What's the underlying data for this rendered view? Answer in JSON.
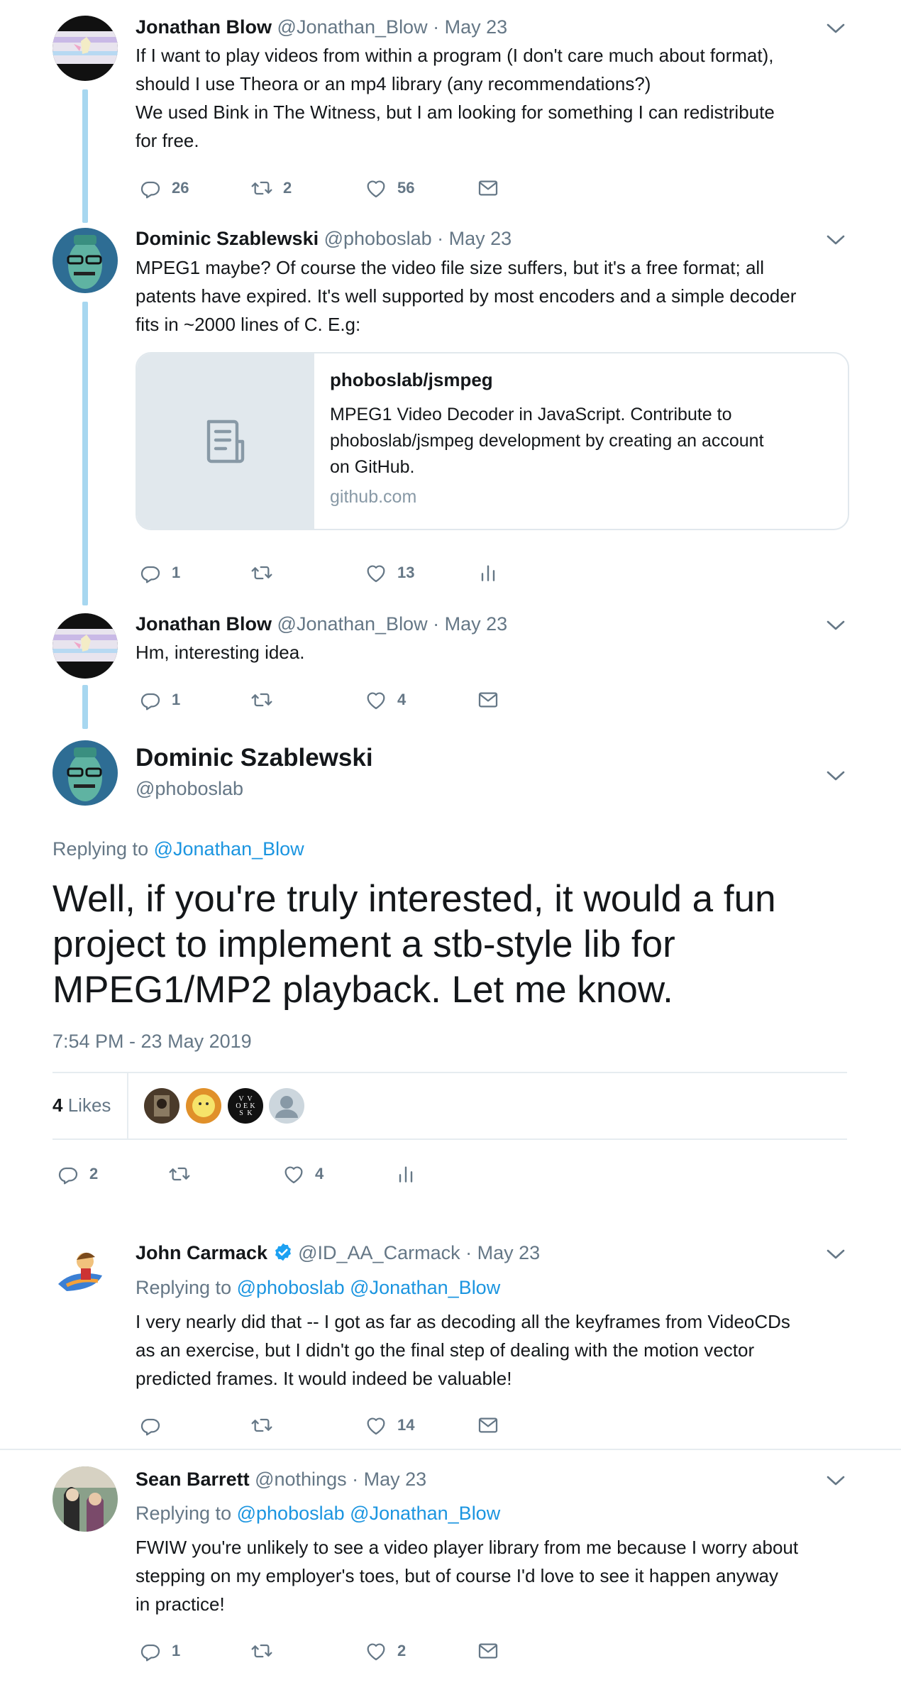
{
  "tweets": [
    {
      "name": "Jonathan Blow",
      "handle": "@Jonathan_Blow",
      "date": "· May 23",
      "lines": [
        "If I want to play videos from within a program (I don't care much about format),",
        "should I use Theora or an mp4 library (any recommendations?)",
        "We used Bink in The Witness, but I am looking for something I can redistribute",
        "for free."
      ],
      "replies": "26",
      "retweets": "2",
      "likes": "56"
    },
    {
      "name": "Dominic Szablewski",
      "handle": "@phoboslab",
      "date": "· May 23",
      "lines": [
        "MPEG1 maybe? Of course the video file size suffers, but it's a free format; all",
        "patents have expired. It's well supported by most encoders and a simple decoder",
        "fits in ~2000 lines of C. E.g:"
      ],
      "card": {
        "title": "phoboslab/jsmpeg",
        "desc": [
          "MPEG1 Video Decoder in JavaScript. Contribute to",
          "phoboslab/jsmpeg development by creating an account",
          "on GitHub."
        ],
        "domain": "github.com",
        "thumb_icon": "document-icon"
      },
      "replies": "1",
      "retweets": "",
      "likes": "13"
    },
    {
      "name": "Jonathan Blow",
      "handle": "@Jonathan_Blow",
      "date": "· May 23",
      "lines": [
        "Hm, interesting idea."
      ],
      "replies": "1",
      "retweets": "",
      "likes": "4"
    }
  ],
  "focus": {
    "name": "Dominic Szablewski",
    "handle": "@phoboslab",
    "replying_label": "Replying to",
    "replying_to": "@Jonathan_Blow",
    "text_lines": [
      "Well, if you're truly interested, it would a fun",
      "project to implement a stb-style lib for",
      "MPEG1/MP2 playback. Let me know."
    ],
    "timestamp": "7:54 PM - 23 May 2019",
    "likes_count": "4",
    "likes_label": "Likes",
    "replies": "2",
    "retweets": "",
    "likes": "4"
  },
  "replies": [
    {
      "name": "John Carmack",
      "verified": true,
      "handle": "@ID_AA_Carmack",
      "date": "· May 23",
      "replying_label": "Replying to",
      "replying_to": [
        "@phoboslab",
        "@Jonathan_Blow"
      ],
      "lines": [
        "I very nearly did that -- I got as far as decoding all the keyframes from VideoCDs",
        "as an exercise, but I didn't go the final step of dealing with the motion vector",
        "predicted frames.  It would indeed be valuable!"
      ],
      "replies": "",
      "retweets": "",
      "likes": "14"
    },
    {
      "name": "Sean Barrett",
      "handle": "@nothings",
      "date": "· May 23",
      "replying_label": "Replying to",
      "replying_to": [
        "@phoboslab",
        "@Jonathan_Blow"
      ],
      "lines": [
        "FWIW you're unlikely to see a video player library from me because I worry about",
        "stepping on my employer's toes, but of course I'd love to see it happen anyway",
        "in practice!"
      ],
      "replies": "1",
      "retweets": "",
      "likes": "2"
    }
  ],
  "colors": {
    "accent": "#1b95e0",
    "secondary_text": "#657786",
    "thread_line": "#a7d7f0",
    "divider": "#e6ecf0"
  },
  "icons": {
    "reply": "reply-icon",
    "retweet": "retweet-icon",
    "like": "heart-icon",
    "dm": "envelope-icon",
    "analytics": "analytics-icon",
    "more": "chevron-down-icon"
  }
}
